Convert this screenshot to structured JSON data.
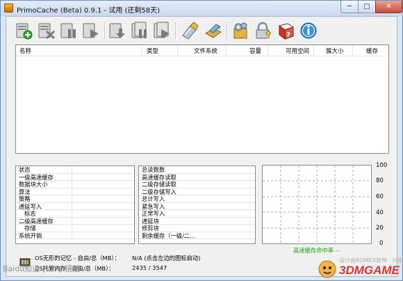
{
  "window": {
    "title": "PrimoCache (Beta) 0.9.1 - 试用 (还剩58天)",
    "minimize": "─",
    "maximize": "□",
    "close": "✕"
  },
  "toolbar": {
    "items": [
      {
        "name": "create-cache-task-button",
        "icon": "add-green"
      },
      {
        "name": "delete-cache-task-button",
        "icon": "delete-x"
      },
      {
        "name": "pause-cache-button",
        "icon": "pause"
      },
      {
        "name": "resume-cache-button",
        "icon": "play"
      },
      {
        "name": "flush-cache-button",
        "icon": "flush-down"
      },
      {
        "name": "pause-all-button",
        "icon": "pause-all"
      },
      {
        "name": "resume-all-button",
        "icon": "resume-all"
      },
      {
        "name": "volume-manager-button",
        "icon": "pen-drive"
      },
      {
        "name": "properties-button",
        "icon": "package"
      },
      {
        "name": "options-button",
        "icon": "gear-box"
      },
      {
        "name": "license-button",
        "icon": "lock-key"
      },
      {
        "name": "help-button",
        "icon": "help-book"
      },
      {
        "name": "about-button",
        "icon": "info"
      }
    ]
  },
  "volume_list": {
    "columns": [
      "名称",
      "类型",
      "文件系统",
      "容量",
      "可用空间",
      "簇大小",
      "缓存"
    ],
    "rows": []
  },
  "stats_left": [
    {
      "label": "状态"
    },
    {
      "label": "一级高速缓存"
    },
    {
      "label": "数据块大小"
    },
    {
      "label": "算法"
    },
    {
      "label": "策略"
    },
    {
      "label": "递延写入"
    },
    {
      "label": "标志",
      "indent": true
    },
    {
      "label": "二级高速缓存"
    },
    {
      "label": "存储",
      "indent": true
    },
    {
      "label": "系统开销"
    }
  ],
  "stats_middle": [
    {
      "label": "总读数数"
    },
    {
      "label": "高速缓存读取"
    },
    {
      "label": "二级存储读取"
    },
    {
      "label": "二级存储写入"
    },
    {
      "label": "总计写入"
    },
    {
      "label": "紧急写入"
    },
    {
      "label": "正常写入"
    },
    {
      "label": "递延块"
    },
    {
      "label": "修剪块"
    },
    {
      "label": "剩余缓存（一级/二..."
    }
  ],
  "graph": {
    "y_ticks": [
      "100",
      "80",
      "60",
      "40",
      "20",
      "0"
    ],
    "hit_rate_label": "高速缓存命中率 --",
    "line_color": "#1aa31a"
  },
  "status": {
    "invisible_memory_label": "OS无形的记忆 - 自由/总（MB）：",
    "invisible_memory_value": "N/A (点击左边的图标启动)",
    "managed_memory_label": "OS托管内存 - 自由/总（MB）：",
    "managed_memory_value": "2435 / 3547"
  },
  "watermarks": {
    "baidu": "Baidu知道 | dn小镜吧",
    "site_sub": "设计由ROMEX软件 · 扫描吧",
    "site": "3DMGAME"
  }
}
